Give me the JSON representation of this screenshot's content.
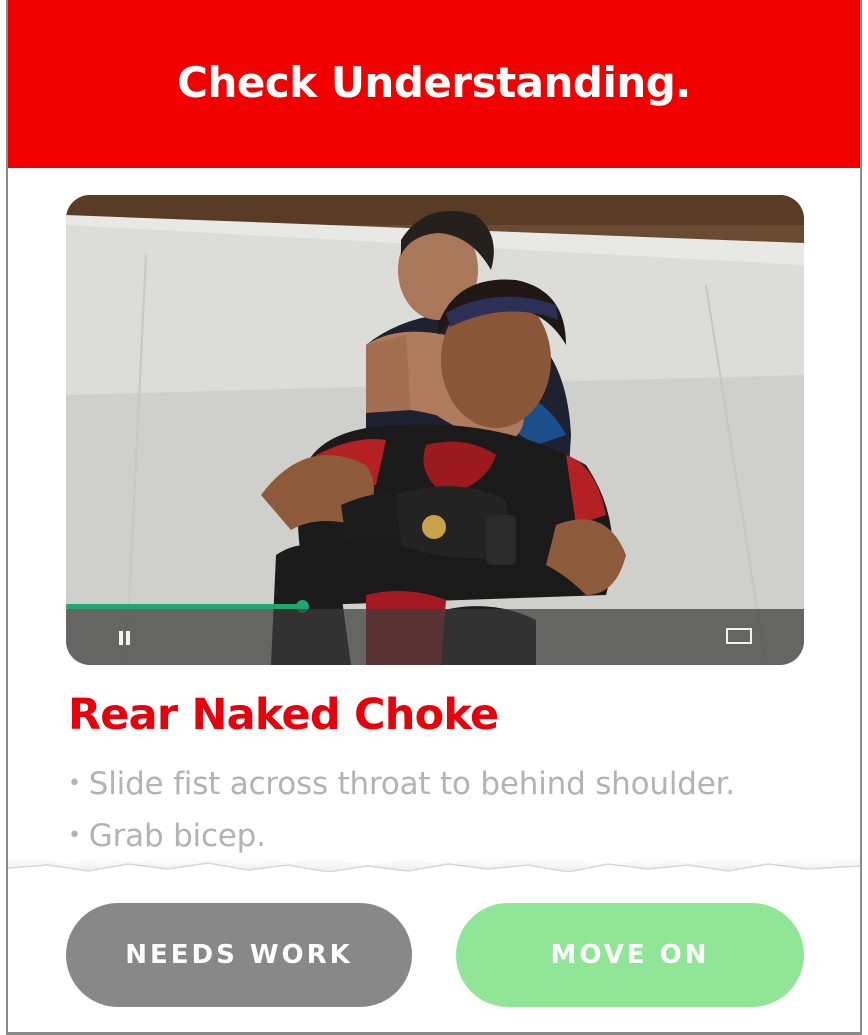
{
  "header": {
    "title": "Check Understanding."
  },
  "video": {
    "progress": 0.32,
    "progress_color": "#1fa86b",
    "controls": {
      "play_state_icon": "pause-icon",
      "fullscreen_icon": "fullscreen-icon"
    }
  },
  "move": {
    "title": "Rear Naked Choke",
    "steps": [
      "Slide fist across throat to behind shoulder.",
      "Grab bicep."
    ],
    "bullet": "•"
  },
  "actions": {
    "needs_work_label": "NEEDS WORK",
    "move_on_label": "MOVE ON"
  },
  "colors": {
    "header_bg": "#f20000",
    "title_red": "#e8000b",
    "needs_work_bg": "#888888",
    "move_on_bg": "#90e596",
    "step_text": "#b3b3b3"
  }
}
